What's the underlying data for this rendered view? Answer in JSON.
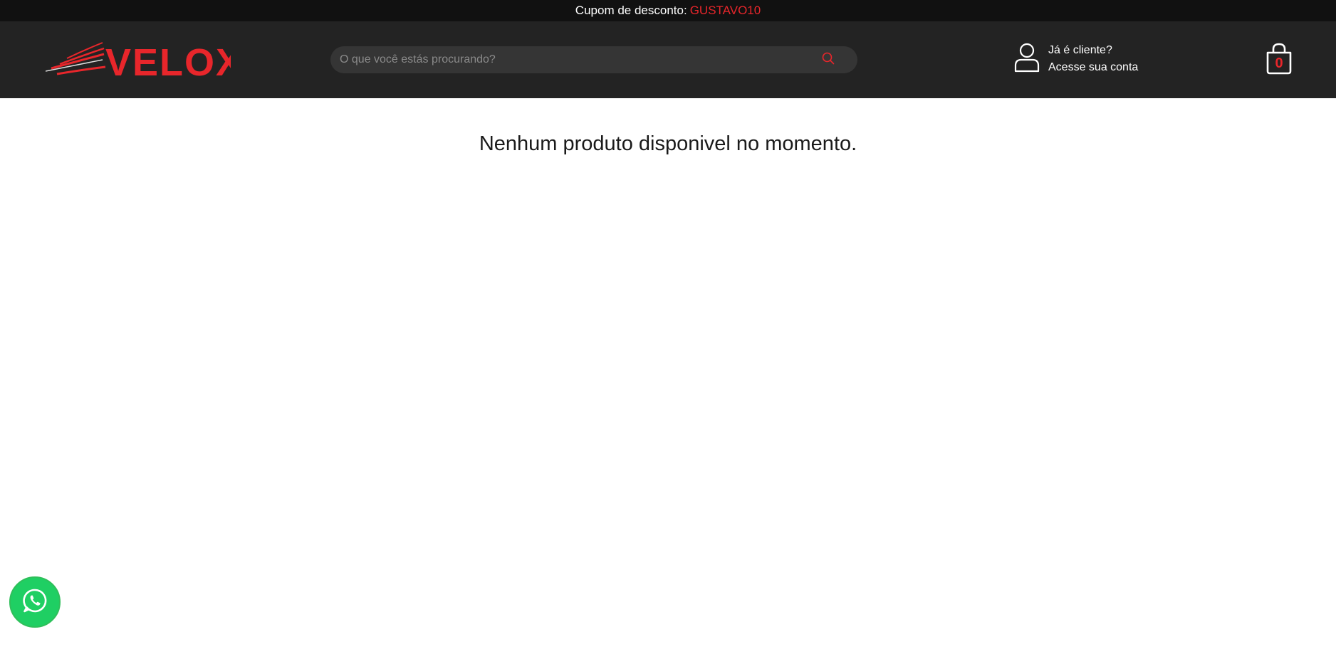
{
  "promo": {
    "label": "Cupom de desconto:",
    "code": "GUSTAVO10"
  },
  "header": {
    "logo_text": "VELOX",
    "search": {
      "placeholder": "O que você estás procurando?",
      "value": ""
    },
    "account": {
      "line1": "Já é cliente?",
      "line2": "Acesse sua conta"
    },
    "cart": {
      "count": "0"
    }
  },
  "main": {
    "empty_message": "Nenhum produto disponivel no momento."
  },
  "colors": {
    "accent": "#e8262b",
    "header_bg": "#232323",
    "promo_bg": "#111111",
    "whatsapp": "#1fcf63"
  },
  "icons": [
    "search-icon",
    "user-icon",
    "shopping-bag-icon",
    "whatsapp-icon"
  ]
}
